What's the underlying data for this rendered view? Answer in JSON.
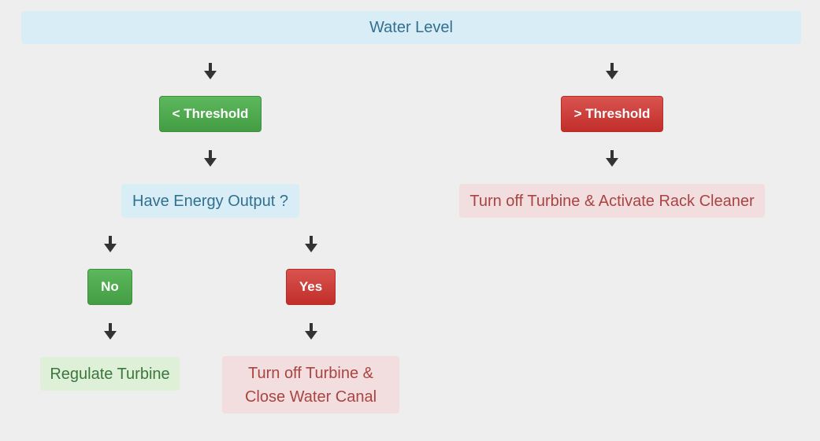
{
  "diagram": {
    "root": {
      "label": "Water Level"
    },
    "left_branch": {
      "condition_label": "< Threshold",
      "question_label": "Have Energy Output ?",
      "no": {
        "label": "No",
        "action": "Regulate Turbine"
      },
      "yes": {
        "label": "Yes",
        "action_line1": "Turn off Turbine &",
        "action_line2": "Close Water Canal"
      }
    },
    "right_branch": {
      "condition_label": "> Threshold",
      "action": "Turn off Turbine & Activate Rack Cleaner"
    }
  },
  "colors": {
    "background": "#eeeeee",
    "info_bg": "#d9edf7",
    "info_text": "#31708f",
    "success_button": "#5cb85c",
    "danger_button": "#d9534f",
    "success_bg": "#dff0d8",
    "success_text": "#3c763d",
    "danger_bg": "#f2dede",
    "danger_text": "#a94442",
    "arrow": "#333333"
  },
  "icons": {
    "arrow": "arrow-down-icon"
  }
}
